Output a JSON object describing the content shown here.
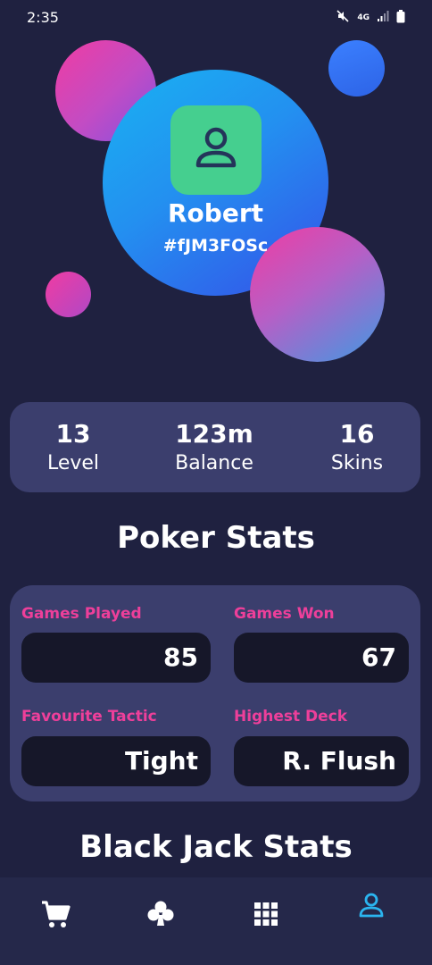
{
  "status_bar": {
    "time": "2:35",
    "network": "4G",
    "icons": [
      "mute-icon",
      "signal-icon",
      "battery-icon"
    ]
  },
  "profile": {
    "name": "Robert",
    "tag": "#fJM3FOSc",
    "avatar_icon": "user-icon"
  },
  "summary": [
    {
      "value": "13",
      "label": "Level"
    },
    {
      "value": "123m",
      "label": "Balance"
    },
    {
      "value": "16",
      "label": "Skins"
    }
  ],
  "poker": {
    "title": "Poker Stats",
    "stats": [
      {
        "label": "Games Played",
        "value": "85"
      },
      {
        "label": "Games Won",
        "value": "67"
      },
      {
        "label": "Favourite Tactic",
        "value": "Tight"
      },
      {
        "label": "Highest Deck",
        "value": "R. Flush"
      }
    ]
  },
  "blackjack": {
    "title": "Black Jack Stats"
  },
  "nav": {
    "items": [
      "cart-icon",
      "club-icon",
      "grid-icon",
      "profile-icon"
    ],
    "active": "profile-icon"
  },
  "colors": {
    "background": "#1f2140",
    "card": "#3b3e6d",
    "accent_pink": "#ee3f9a",
    "avatar_green": "#45cf8f",
    "nav_active": "#2bb5f0"
  }
}
